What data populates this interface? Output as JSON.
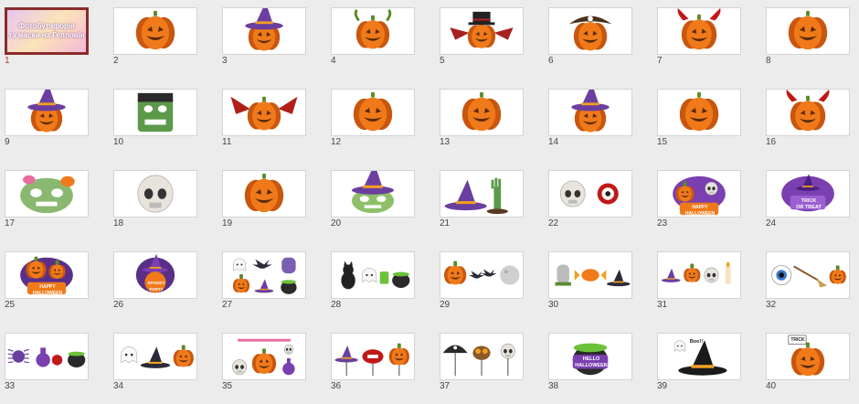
{
  "cover": {
    "title_line1": "Фотобутафорія",
    "title_line2": "та маски на Гелловін"
  },
  "slides": [
    {
      "number": "1",
      "icon": "cover-slide",
      "selected": true
    },
    {
      "number": "2",
      "icon": "jack-o-lantern"
    },
    {
      "number": "3",
      "icon": "pumpkin-witch-hat"
    },
    {
      "number": "4",
      "icon": "pumpkin-horns"
    },
    {
      "number": "5",
      "icon": "pumpkin-top-hat-bat-wings"
    },
    {
      "number": "6",
      "icon": "pumpkin-pirate-hat"
    },
    {
      "number": "7",
      "icon": "pumpkin-devil-horns"
    },
    {
      "number": "8",
      "icon": "jack-o-lantern"
    },
    {
      "number": "9",
      "icon": "pumpkin-witch-hat"
    },
    {
      "number": "10",
      "icon": "frankenstein-mask"
    },
    {
      "number": "11",
      "icon": "pumpkin-bat-wings"
    },
    {
      "number": "12",
      "icon": "jack-o-lantern"
    },
    {
      "number": "13",
      "icon": "jack-o-lantern"
    },
    {
      "number": "14",
      "icon": "pumpkin-witch-hat"
    },
    {
      "number": "15",
      "icon": "jack-o-lantern"
    },
    {
      "number": "16",
      "icon": "pumpkin-devil-horns"
    },
    {
      "number": "17",
      "icon": "zombie-mask"
    },
    {
      "number": "18",
      "icon": "skull-mask"
    },
    {
      "number": "19",
      "icon": "jack-o-lantern"
    },
    {
      "number": "20",
      "icon": "witch-mask"
    },
    {
      "number": "21",
      "icon": "witch-hat-zombie-hand"
    },
    {
      "number": "22",
      "icon": "skull-eyeball"
    },
    {
      "number": "23",
      "icon": "happy-halloween-sign"
    },
    {
      "number": "24",
      "icon": "trick-or-treat-sign"
    },
    {
      "number": "25",
      "icon": "happy-halloween-pumpkins"
    },
    {
      "number": "26",
      "icon": "spooky-party-sign"
    },
    {
      "number": "27",
      "icon": "props-ghost-bat-tombstone"
    },
    {
      "number": "28",
      "icon": "props-cat-ghost-cauldron"
    },
    {
      "number": "29",
      "icon": "props-pumpkin-bats-moon"
    },
    {
      "number": "30",
      "icon": "props-tombstone-candy-hat"
    },
    {
      "number": "31",
      "icon": "props-hat-pumpkin-skull-candle"
    },
    {
      "number": "32",
      "icon": "props-eye-broom-pumpkin"
    },
    {
      "number": "33",
      "icon": "props-spider-potion-cauldron"
    },
    {
      "number": "34",
      "icon": "props-ghost-hat-pumpkin"
    },
    {
      "number": "35",
      "icon": "props-skulls-potions"
    },
    {
      "number": "36",
      "icon": "props-hat-lips-pumpkin"
    },
    {
      "number": "37",
      "icon": "props-pirate-hat-owl-skull"
    },
    {
      "number": "38",
      "icon": "hello-pumpkin-cauldron"
    },
    {
      "number": "39",
      "icon": "ghost-witch-hat"
    },
    {
      "number": "40",
      "icon": "trick-pumpkin-sign"
    }
  ],
  "deco_texts": {
    "happy_halloween": [
      "HAPPY",
      "HALLOWEEN"
    ],
    "trick_or_treat": [
      "TRICK",
      "OR TREAT"
    ],
    "spooky_party": [
      "SPOOKY",
      "PARTY"
    ],
    "hello": [
      "HELLO",
      "HALLOWEEN"
    ],
    "booo": "Boo!!",
    "trick": "TRICK"
  },
  "colors": {
    "background": "#ececec",
    "selection_border": "#8b2b2b",
    "selected_number": "#c0392b",
    "pumpkin": "#f07a1a",
    "pumpkin_dark": "#c8560e",
    "stem": "#5a8a2a",
    "witch_purple": "#6b3fa0",
    "frank_green": "#5c9a4a",
    "bone": "#e8e4dc"
  }
}
